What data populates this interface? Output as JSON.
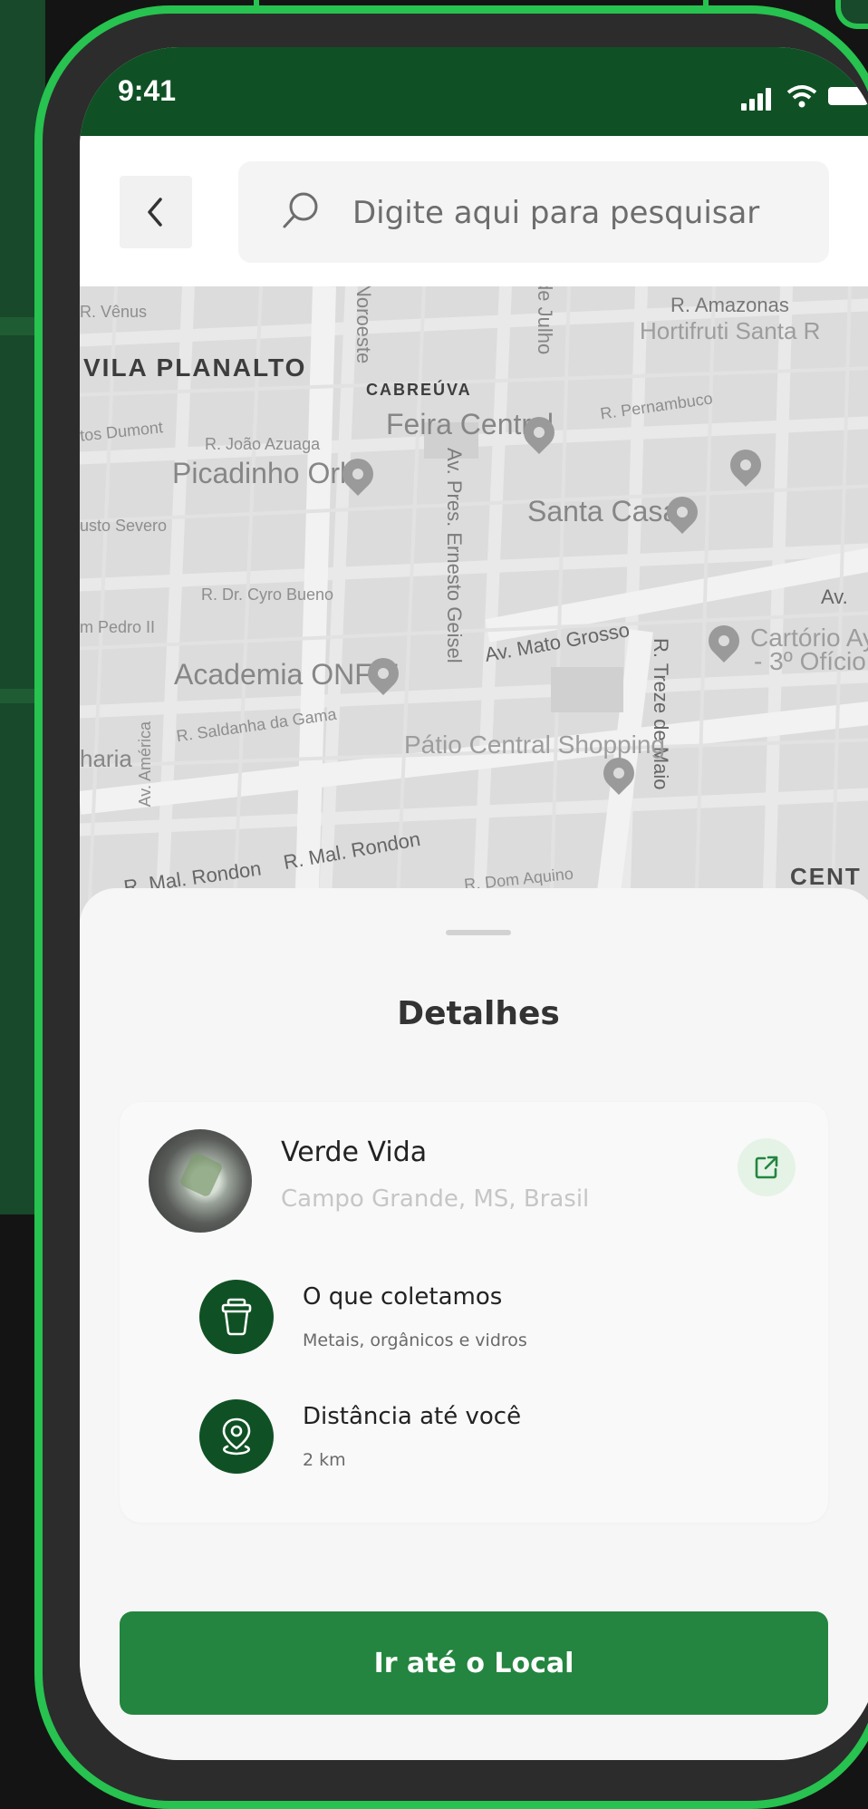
{
  "status_bar": {
    "time": "9:41"
  },
  "header": {
    "back_icon": "chevron-left-icon",
    "search": {
      "placeholder": "Digite aqui para pesquisar",
      "icon": "search-icon"
    }
  },
  "map": {
    "labels": {
      "neighborhood": "VILA PLANALTO",
      "district": "CABREÚVA",
      "center": "CENT",
      "feira": "Feira Central",
      "picadinho": "Picadinho Orla",
      "santa_casa": "Santa Casa",
      "academia": "Academia ONFIT",
      "patio": "Pátio Central Shopping",
      "cartorio_1": "Cartório Ay",
      "cartorio_2": "- 3º Ofício",
      "hortifruti": "Hortifruti Santa R",
      "amazonas": "R. Amazonas",
      "pernambuco": "R. Pernambuco",
      "mato_grosso": "Av. Mato Grosso",
      "ernesto": "Av. Pres. Ernesto Geisel",
      "treze_maio": "R. Treze de Maio",
      "rondon_1": "R. Mal. Rondon",
      "rondon_2": "R. Mal. Rondon",
      "dom_aquino": "R. Dom Aquino",
      "joao_azuaga": "R. João Azuaga",
      "cyro_bueno": "R. Dr. Cyro Bueno",
      "saldanha": "R. Saldanha da Gama",
      "dumont": "tos Dumont",
      "severo": "usto Severo",
      "pedro": "m Pedro II",
      "venus": "R. Vênus",
      "noroeste": "Noroeste",
      "julho": "de Julho",
      "america": "Av. América",
      "haria": "haria",
      "av_right": "Av."
    }
  },
  "sheet": {
    "title": "Detalhes",
    "place": {
      "name": "Verde Vida",
      "location": "Campo Grande, MS, Brasil"
    },
    "info": [
      {
        "icon": "trash-bin-icon",
        "title": "O que coletamos",
        "value": "Metais, orgânicos e vidros"
      },
      {
        "icon": "location-pin-icon",
        "title": "Distância até você",
        "value": "2 km"
      }
    ],
    "action_label": "Ir até o Local"
  },
  "colors": {
    "primary_dark": "#0f5124",
    "primary": "#23853f",
    "frame_accent": "#27c24f"
  }
}
